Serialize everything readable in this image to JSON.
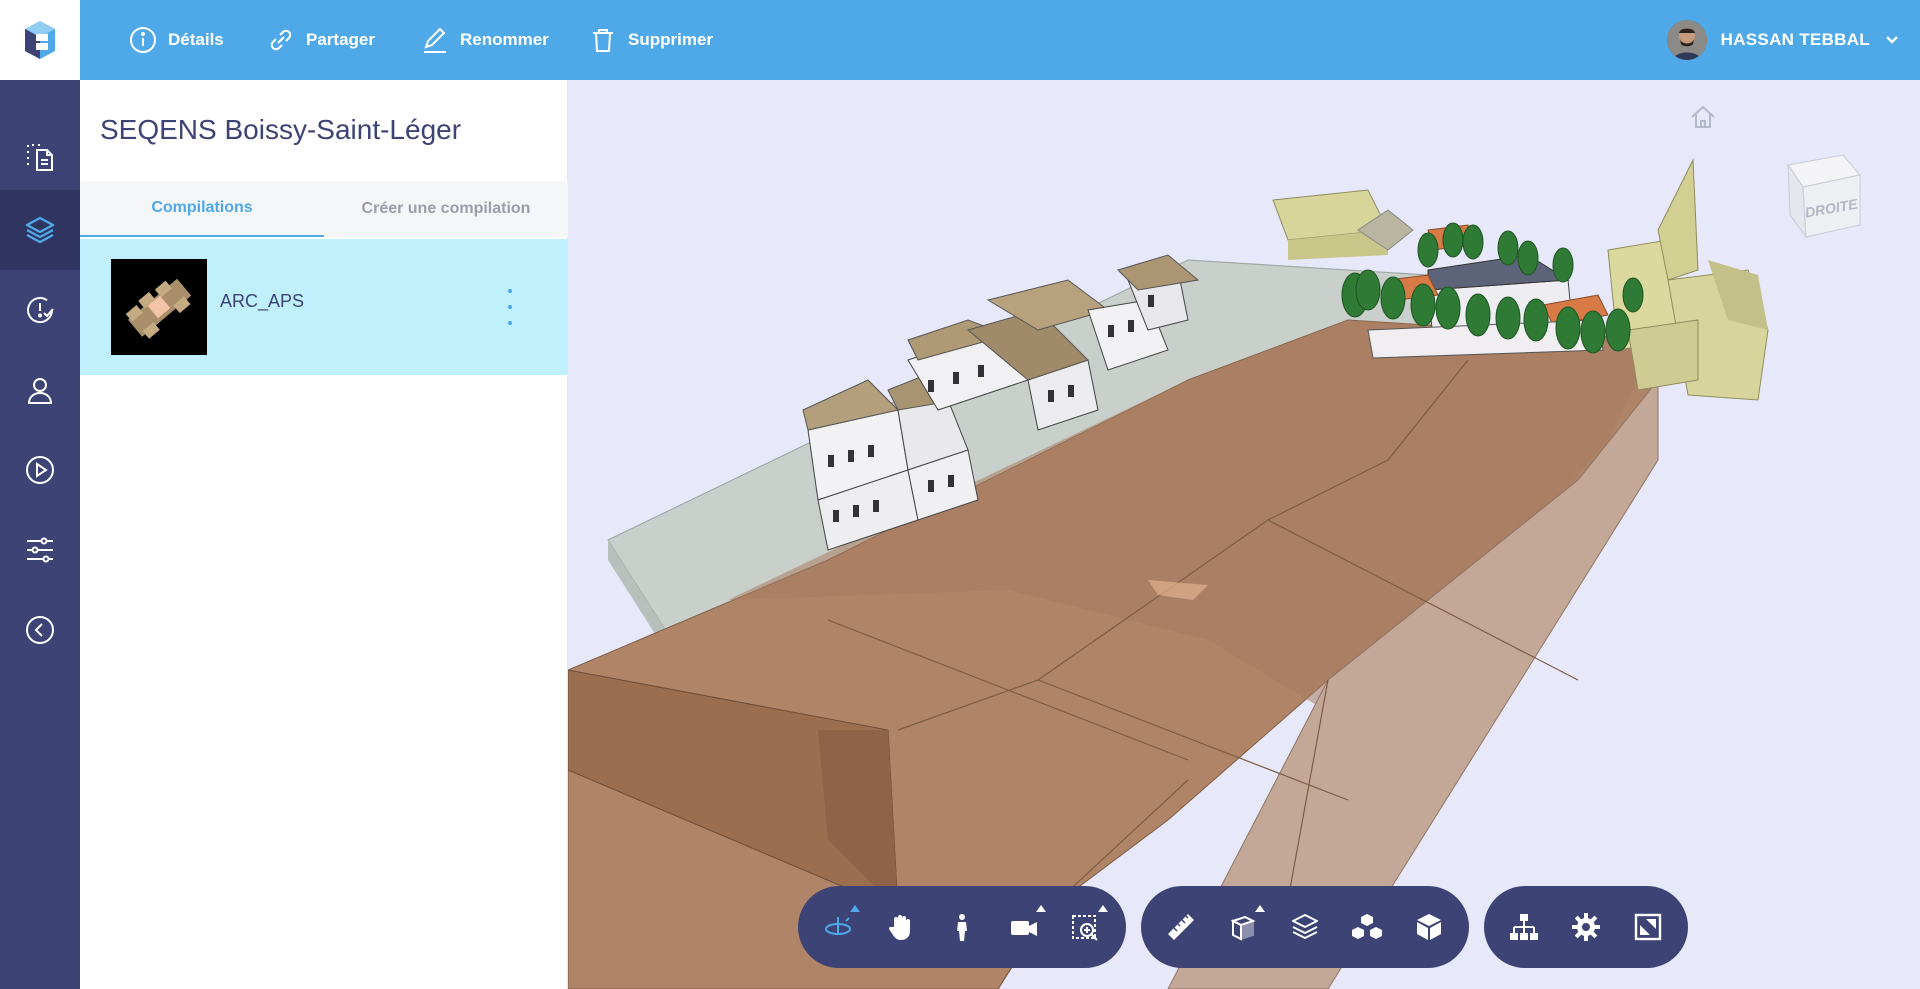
{
  "colors": {
    "primary": "#4fa9e8",
    "rail": "#3d4375",
    "selected_row": "#bff0fb"
  },
  "topbar": {
    "actions": [
      {
        "label": "Détails",
        "icon": "info-icon"
      },
      {
        "label": "Partager",
        "icon": "link-icon"
      },
      {
        "label": "Renommer",
        "icon": "pencil-icon"
      },
      {
        "label": "Supprimer",
        "icon": "trash-icon"
      }
    ],
    "user": {
      "name": "HASSAN TEBBAL"
    }
  },
  "rail": {
    "items": [
      {
        "icon": "document-selection-icon"
      },
      {
        "icon": "layers-icon",
        "active": true
      },
      {
        "icon": "issue-check-icon"
      },
      {
        "icon": "user-icon"
      },
      {
        "icon": "play-icon"
      },
      {
        "icon": "sliders-icon"
      },
      {
        "icon": "collapse-left-icon"
      }
    ]
  },
  "panel": {
    "title": "SEQENS Boissy-Saint-Léger",
    "tabs": [
      {
        "label": "Compilations",
        "active": true
      },
      {
        "label": "Créer une compilation",
        "active": false
      }
    ],
    "items": [
      {
        "name": "ARC_APS"
      }
    ]
  },
  "viewer": {
    "navcube_face": "DROITE"
  },
  "toolbars": [
    {
      "tools": [
        "orbit-icon",
        "pan-hand-icon",
        "walk-person-icon",
        "camera-icon",
        "zoom-window-icon"
      ]
    },
    {
      "tools": [
        "ruler-icon",
        "section-box-icon",
        "layers-stack-icon",
        "explode-icon",
        "cube-icon"
      ]
    },
    {
      "tools": [
        "tree-structure-icon",
        "gear-icon",
        "fullscreen-icon"
      ]
    }
  ]
}
